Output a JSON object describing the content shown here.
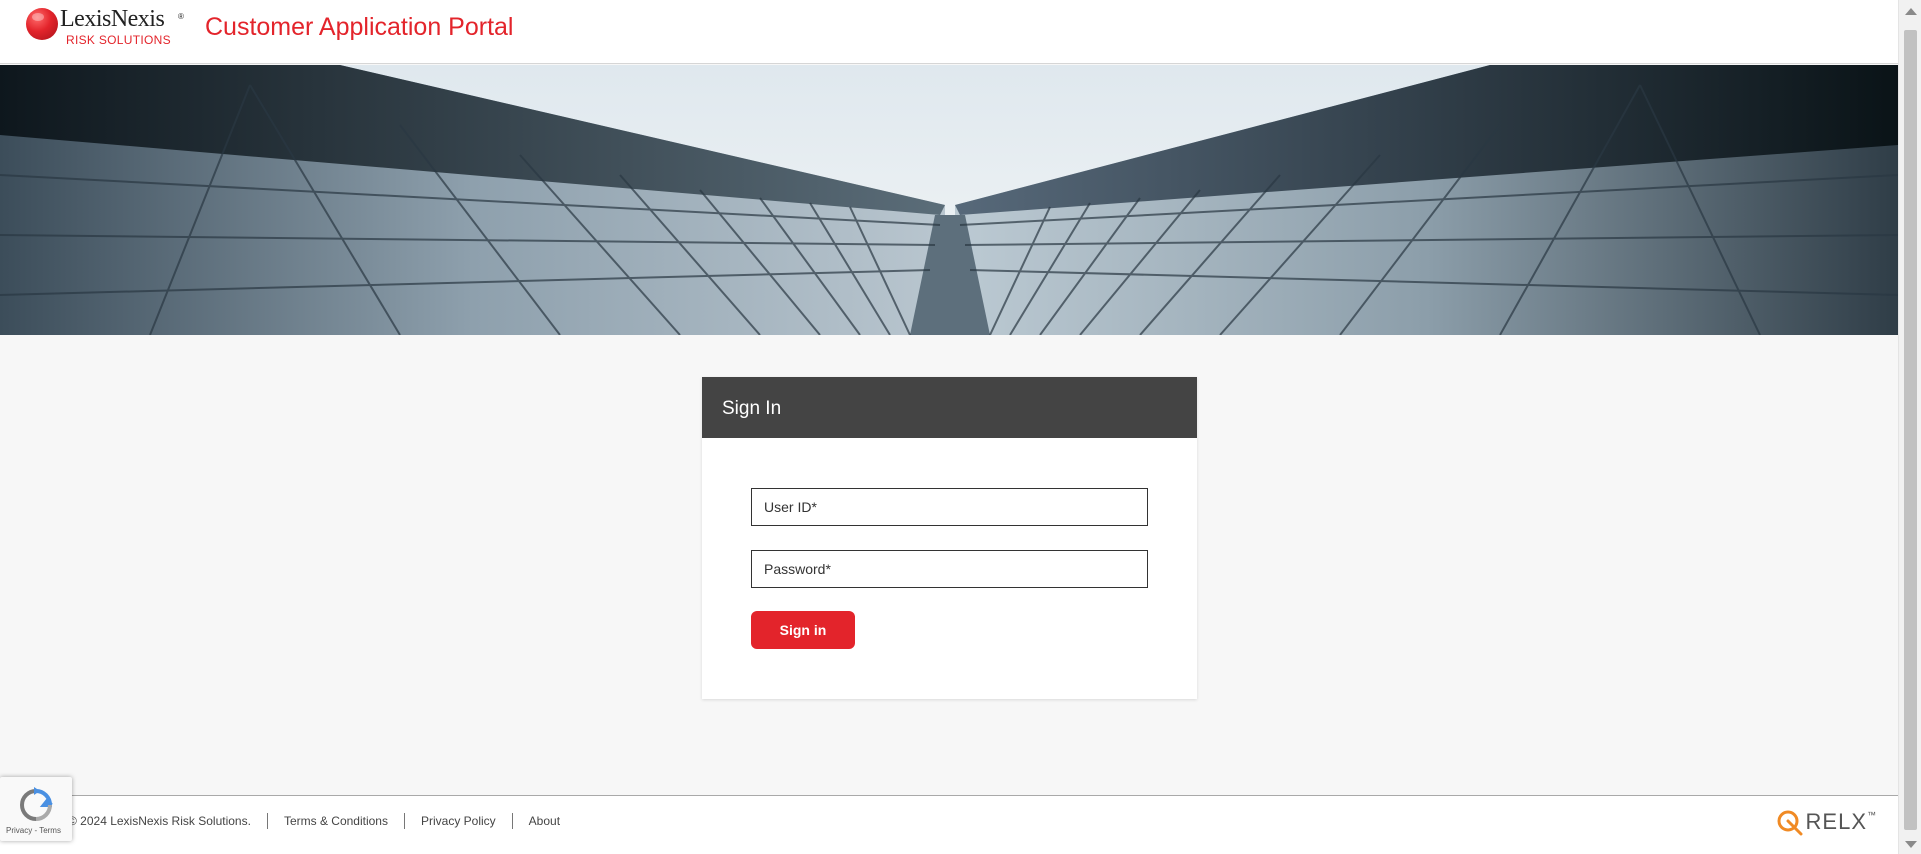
{
  "header": {
    "logo_name": "LexisNexis",
    "logo_registered": "®",
    "logo_subtitle": "RISK SOLUTIONS",
    "portal_title": "Customer Application Portal"
  },
  "signin": {
    "title": "Sign In",
    "user_placeholder": "User ID*",
    "password_placeholder": "Password*",
    "button_label": "Sign in"
  },
  "footer": {
    "copyright": "© 2024 LexisNexis Risk Solutions.",
    "links": [
      "Terms & Conditions",
      "Privacy Policy",
      "About"
    ],
    "brand": "RELX",
    "brand_tm": "™"
  },
  "recaptcha": {
    "links": "Privacy - Terms"
  },
  "colors": {
    "brand_red": "#e3242b",
    "card_header": "#444444",
    "relx_orange": "#f08a24"
  },
  "icons": {
    "logo": "lexisnexis-logo",
    "recaptcha": "recaptcha-icon",
    "relx": "relx-logo-icon"
  }
}
